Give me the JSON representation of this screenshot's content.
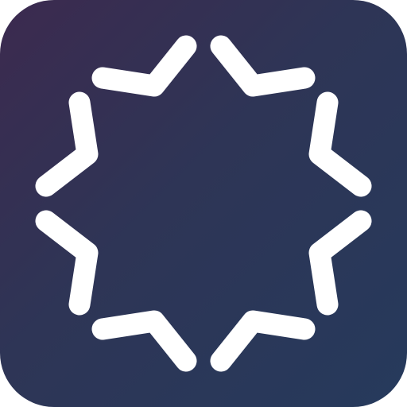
{
  "app_icon": {
    "name": "starburst-app-icon",
    "colors": {
      "background_top_left": "#3c2a4f",
      "background_bottom_right": "#263a5c",
      "glyph": "#ffffff",
      "page": "#ffffff"
    },
    "glyph": {
      "shape": "eight-point starburst outline",
      "stroke_segments": 8
    }
  }
}
